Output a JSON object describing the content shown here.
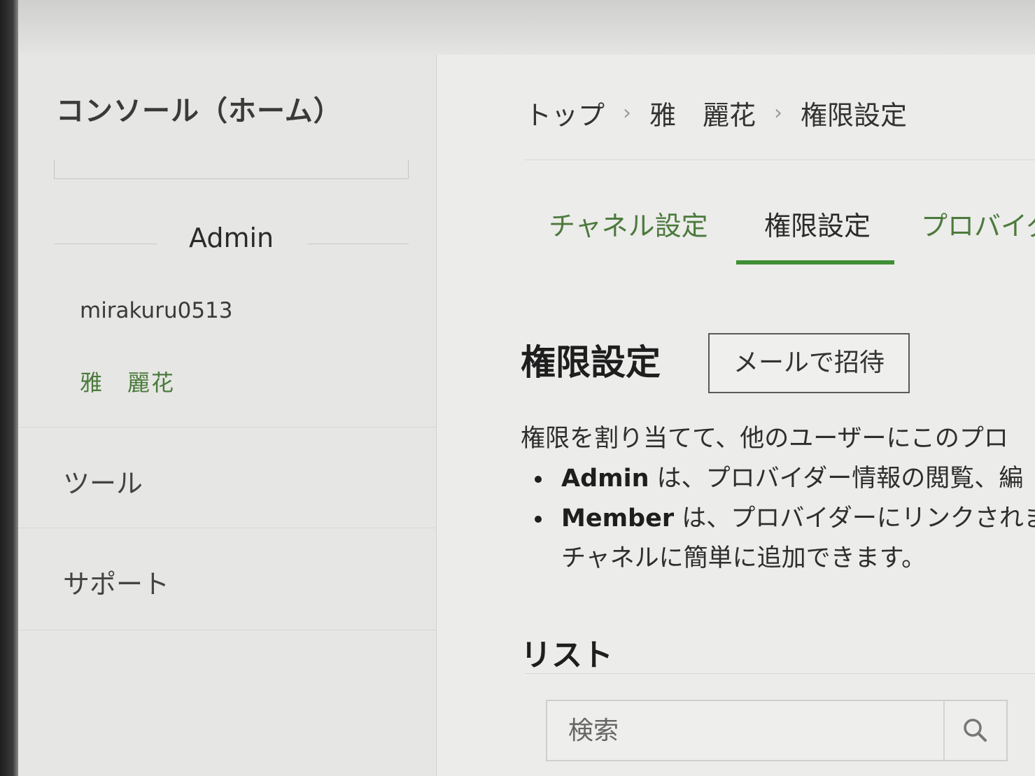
{
  "sidebar": {
    "title": "コンソール（ホーム）",
    "role": "Admin",
    "account_id": "mirakuru0513",
    "account_name": "雅　麗花",
    "nav": [
      {
        "label": "ツール"
      },
      {
        "label": "サポート"
      }
    ]
  },
  "breadcrumb": {
    "items": [
      "トップ",
      "雅　麗花",
      "権限設定"
    ],
    "separator": "›"
  },
  "tabs": [
    {
      "label": "チャネル設定",
      "active": false
    },
    {
      "label": "権限設定",
      "active": true
    },
    {
      "label": "プロバイダ",
      "active": false
    }
  ],
  "page": {
    "title": "権限設定",
    "invite_button": "メールで招待",
    "description": "権限を割り当てて、他のユーザーにこのプロ",
    "bullets": [
      {
        "strong": "Admin",
        "text": " は、プロバイダー情報の閲覧、編"
      },
      {
        "strong": "Member",
        "text": " は、プロバイダーにリンクされま",
        "continuation": "チャネルに簡単に追加できます。"
      }
    ],
    "list_title": "リスト",
    "search": {
      "placeholder": "検索",
      "icon": "search-icon"
    }
  },
  "colors": {
    "accent_green": "#3f8f35",
    "link_green": "#4b7a3c"
  }
}
